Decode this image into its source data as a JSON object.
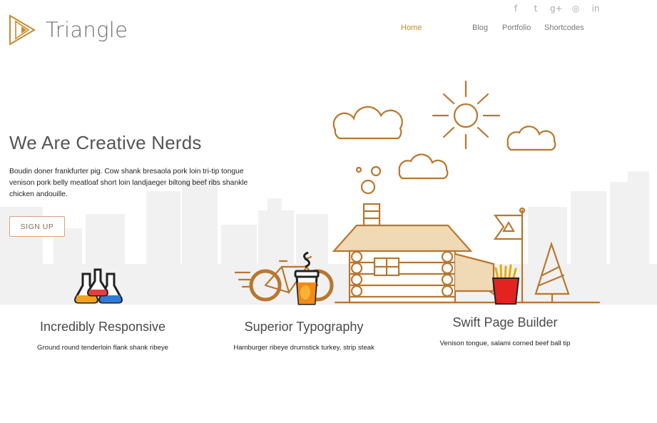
{
  "brand": {
    "name": "Triangle",
    "accent": "#c9892a"
  },
  "social": [
    {
      "icon": "facebook-icon",
      "glyph": "f"
    },
    {
      "icon": "twitter-icon",
      "glyph": "t"
    },
    {
      "icon": "google-plus-icon",
      "glyph": "g+"
    },
    {
      "icon": "dribbble-icon",
      "glyph": "◎"
    },
    {
      "icon": "linkedin-icon",
      "glyph": "in"
    }
  ],
  "nav": [
    {
      "label": "Home",
      "active": true
    },
    {
      "label": "Blog",
      "active": false
    },
    {
      "label": "Portfolio",
      "active": false
    },
    {
      "label": "Shortcodes",
      "active": false
    }
  ],
  "hero": {
    "title": "We Are Creative Nerds",
    "description": "Boudin doner frankfurter pig. Cow shank bresaola pork loin tri-tip tongue venison pork belly meatloaf short loin landjaeger biltong beef ribs shankle chicken andouille.",
    "cta": "SIGN UP"
  },
  "features": [
    {
      "icon": "flasks-icon",
      "title": "Incredibly Responsive",
      "text": "Ground round tenderloin flank shank ribeye"
    },
    {
      "icon": "coffee-cup-icon",
      "title": "Superior Typography",
      "text": "Hamburger ribeye drumstick turkey, strip steak"
    },
    {
      "icon": "fries-icon",
      "title": "Swift Page Builder",
      "text": "Venison tongue, salami corned beef ball tip"
    }
  ]
}
